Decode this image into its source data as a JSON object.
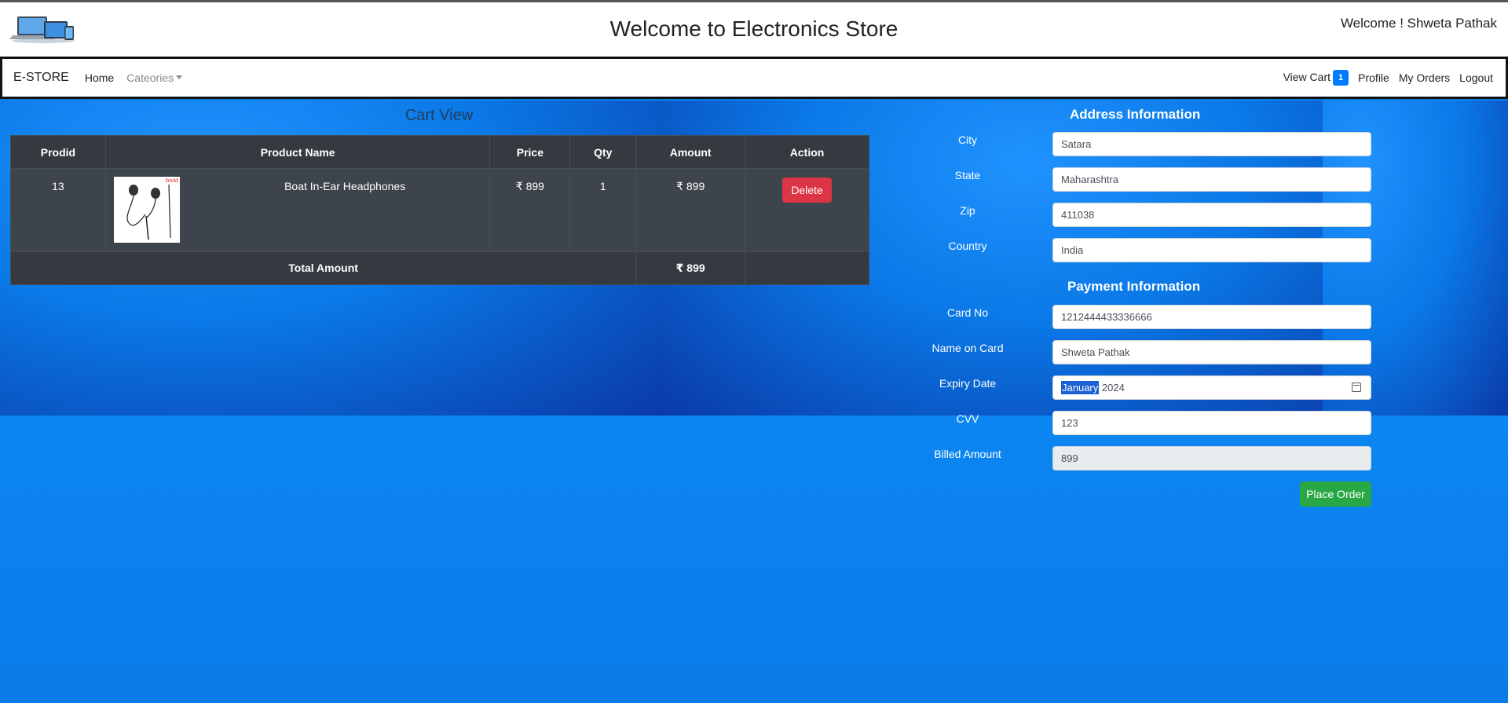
{
  "header": {
    "title": "Welcome to Electronics Store",
    "welcome": "Welcome ! Shweta Pathak"
  },
  "nav": {
    "brand": "E-STORE",
    "home": "Home",
    "categories": "Cateories",
    "view_cart": "View Cart",
    "cart_count": "1",
    "profile": "Profile",
    "my_orders": "My Orders",
    "logout": "Logout"
  },
  "cart": {
    "title": "Cart View",
    "columns": [
      "Prodid",
      "Product Name",
      "Price",
      "Qty",
      "Amount",
      "Action"
    ],
    "items": [
      {
        "prodid": "13",
        "name": "Boat In-Ear Headphones",
        "price": "₹ 899",
        "qty": "1",
        "amount": "₹ 899",
        "action": "Delete"
      }
    ],
    "total_label": "Total Amount",
    "total_value": "₹ 899"
  },
  "address": {
    "title": "Address Information",
    "city_label": "City",
    "city": "Satara",
    "state_label": "State",
    "state": "Maharashtra",
    "zip_label": "Zip",
    "zip": "411038",
    "country_label": "Country",
    "country": "India"
  },
  "payment": {
    "title": "Payment Information",
    "card_label": "Card No",
    "card": "1212444433336666",
    "name_label": "Name on Card",
    "name": "Shweta Pathak",
    "expiry_label": "Expiry Date",
    "expiry_month": "January",
    "expiry_year": "2024",
    "cvv_label": "CVV",
    "cvv": "123",
    "billed_label": "Billed Amount",
    "billed": "899",
    "place_order": "Place Order"
  },
  "colors": {
    "navbar_badge": "#007bff",
    "delete_button": "#dc3545",
    "order_button": "#28a745",
    "table_bg": "#343a40"
  }
}
